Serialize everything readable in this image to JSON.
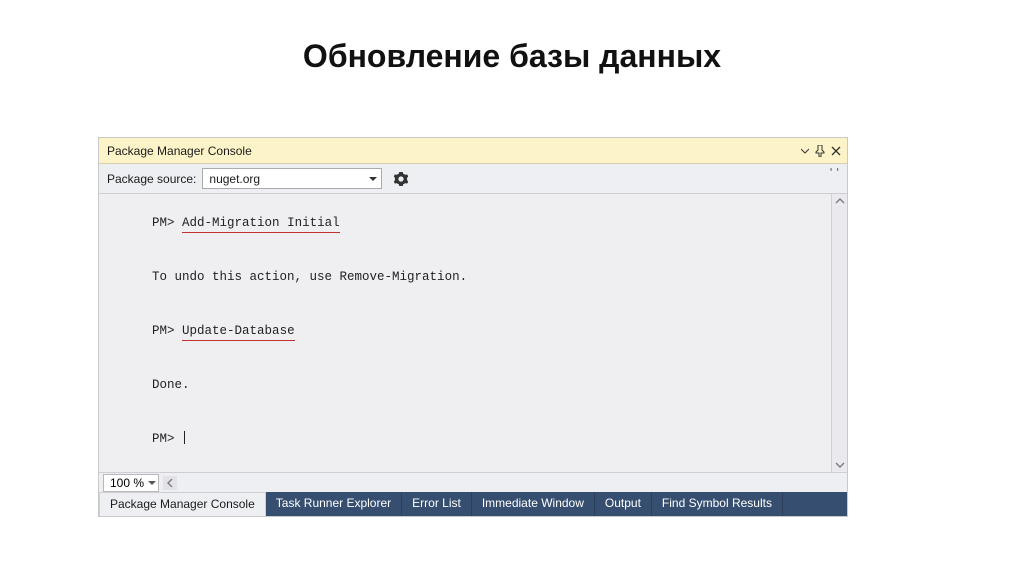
{
  "page": {
    "title": "Обновление базы данных"
  },
  "pmc": {
    "title": "Package Manager Console",
    "toolbar": {
      "source_label": "Package source:",
      "source_value": "nuget.org"
    },
    "console": {
      "prompt": "PM>",
      "lines": [
        {
          "prompt": "PM>",
          "text": "Add-Migration Initial",
          "highlighted": true
        },
        {
          "prompt": "",
          "text": "To undo this action, use Remove-Migration.",
          "highlighted": false
        },
        {
          "prompt": "PM>",
          "text": "Update-Database",
          "highlighted": true
        },
        {
          "prompt": "",
          "text": "Done.",
          "highlighted": false
        },
        {
          "prompt": "PM>",
          "text": "",
          "highlighted": false,
          "cursor": true
        }
      ]
    },
    "zoom": "100 %",
    "tabs": [
      "Package Manager Console",
      "Task Runner Explorer",
      "Error List",
      "Immediate Window",
      "Output",
      "Find Symbol Results"
    ]
  }
}
